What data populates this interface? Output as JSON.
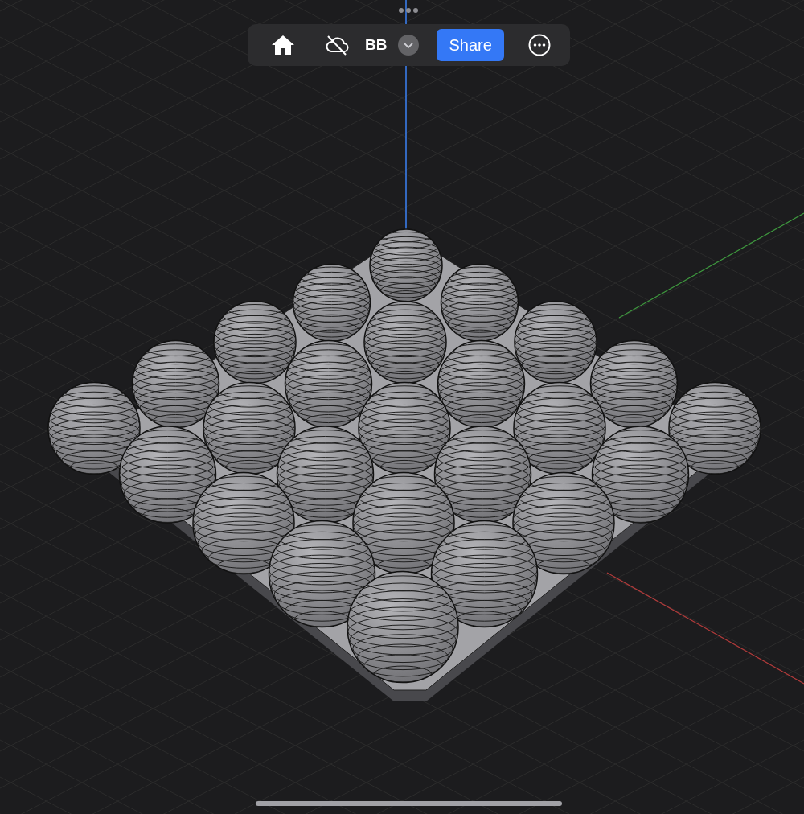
{
  "toolbar": {
    "document_title": "BB",
    "share_button": "Share"
  }
}
